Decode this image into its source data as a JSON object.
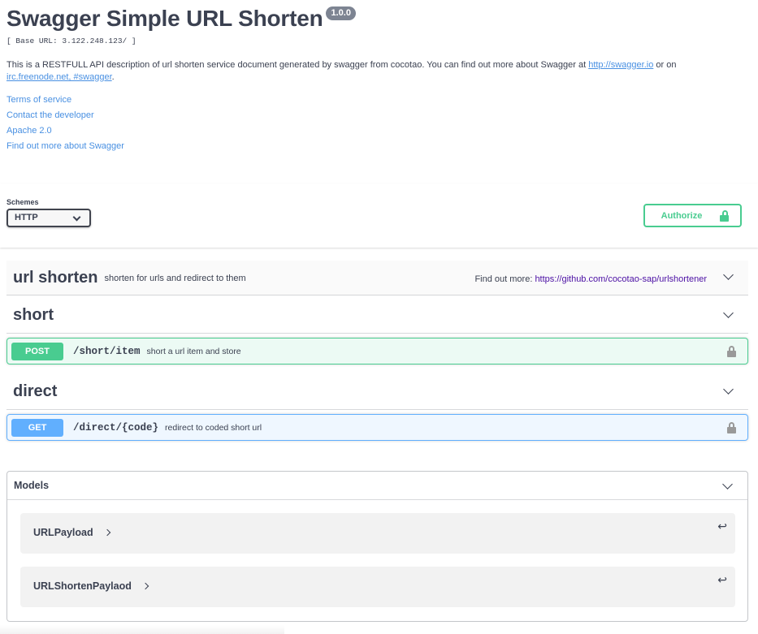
{
  "info": {
    "title": "Swagger Simple URL Shorten",
    "version": "1.0.0",
    "base_url": "[ Base URL: 3.122.248.123/ ]",
    "description_text": "This is a RESTFULL API description of url shorten service document generated by swagger from cocotao. You can find out more about Swagger at ",
    "description_link1": "http://swagger.io",
    "description_mid": " or on ",
    "description_link2": "irc.freenode.net, #swagger",
    "description_end": ".",
    "links": {
      "terms": "Terms of service",
      "contact": "Contact the developer",
      "license": "Apache 2.0",
      "external_docs": "Find out more about Swagger"
    }
  },
  "schemes": {
    "label": "Schemes",
    "selected": "HTTP"
  },
  "authorize": {
    "label": "Authorize"
  },
  "tags": [
    {
      "name": "url shorten",
      "description": "shorten for urls and redirect to them",
      "find_out_more_label": "Find out more:",
      "find_out_more_link": "https://github.com/cocotao-sap/urlshortener"
    },
    {
      "name": "short",
      "operations": [
        {
          "method": "POST",
          "path": "/short/item",
          "summary": "short a url item and store"
        }
      ]
    },
    {
      "name": "direct",
      "operations": [
        {
          "method": "GET",
          "path": "/direct/{code}",
          "summary": "redirect to coded short url"
        }
      ]
    }
  ],
  "models": {
    "title": "Models",
    "items": [
      {
        "name": "URLPayload"
      },
      {
        "name": "URLShortenPaylaod"
      }
    ]
  },
  "colors": {
    "post": "#49cc90",
    "get": "#61affe",
    "link": "#4990e2",
    "text": "#3b4151"
  }
}
